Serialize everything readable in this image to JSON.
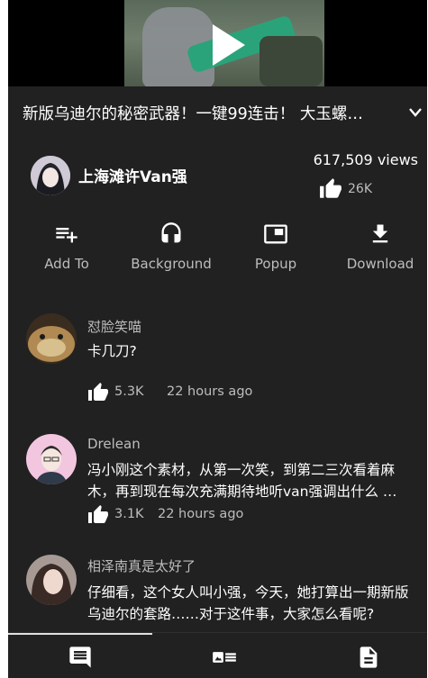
{
  "video": {
    "title": "新版乌迪尔的秘密武器！一键99连击！ 大玉螺…",
    "uploader": "上海滩许Van强",
    "views": "617,509 views",
    "likes": "26K"
  },
  "actions": [
    {
      "label": "Add To",
      "icon": "playlist-add-icon"
    },
    {
      "label": "Background",
      "icon": "headphones-icon"
    },
    {
      "label": "Popup",
      "icon": "popup-icon"
    },
    {
      "label": "Download",
      "icon": "download-icon"
    }
  ],
  "comments": [
    {
      "author": "怼脸笑喵",
      "text": "卡几刀?",
      "likes": "5.3K",
      "time": "22 hours ago"
    },
    {
      "author": "Drelean",
      "text": "冯小刚这个素材，从第一次笑，到第二三次看着麻木，再到现在每次充满期待地听van强调出什么 …",
      "likes": "3.1K",
      "time": "22 hours ago"
    },
    {
      "author": "相泽南真是太好了",
      "text": "仔细看，这个女人叫小强，今天，她打算出一期新版乌迪尔的套路……对于这件事，大家怎么看呢?"
    }
  ],
  "bottom_nav": [
    "comments-tab-icon",
    "related-videos-tab-icon",
    "description-tab-icon"
  ],
  "colors": {
    "background": "#212121",
    "text": "#ffffff",
    "secondary_text": "#bdbdbd"
  }
}
